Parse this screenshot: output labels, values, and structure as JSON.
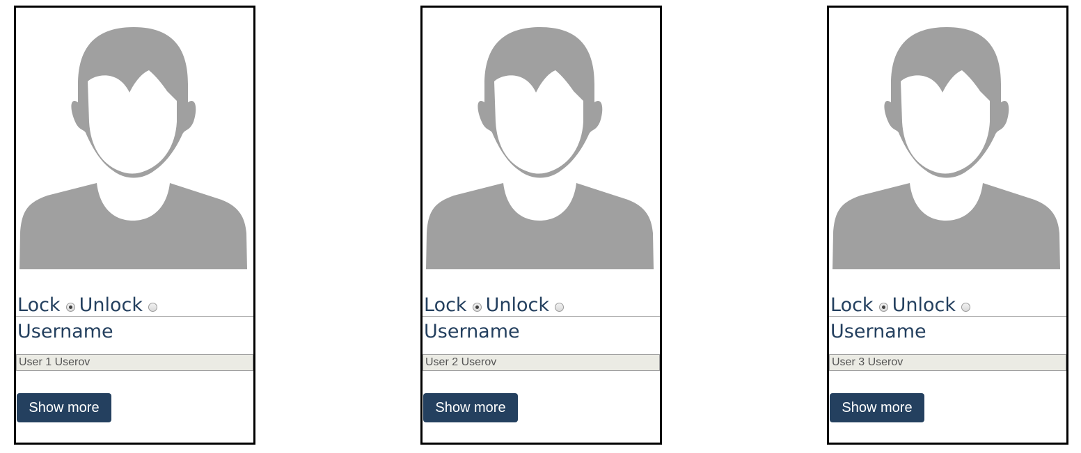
{
  "cards": [
    {
      "lock_label": "Lock",
      "unlock_label": "Unlock",
      "lock_selected": true,
      "username_label": "Username",
      "username_value": "User 1 Userov",
      "show_more_label": "Show more"
    },
    {
      "lock_label": "Lock",
      "unlock_label": "Unlock",
      "lock_selected": true,
      "username_label": "Username",
      "username_value": "User 2 Userov",
      "show_more_label": "Show more"
    },
    {
      "lock_label": "Lock",
      "unlock_label": "Unlock",
      "lock_selected": true,
      "username_label": "Username",
      "username_value": "User 3 Userov",
      "show_more_label": "Show more"
    }
  ],
  "avatar_icon": "default-user-avatar-icon",
  "colors": {
    "accent": "#24405f",
    "avatar_gray": "#a0a0a0",
    "field_bg": "#ebebe4"
  }
}
